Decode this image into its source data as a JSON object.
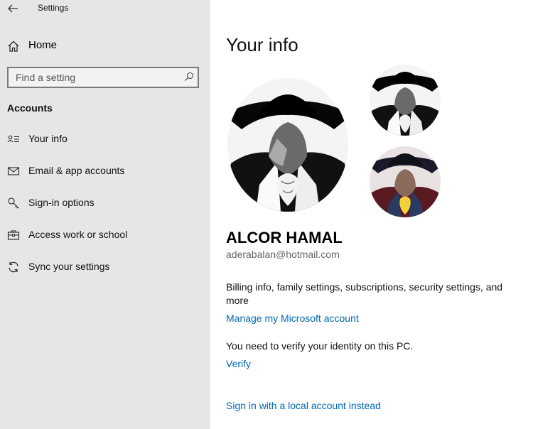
{
  "app": {
    "title": "Settings"
  },
  "sidebar": {
    "home_label": "Home",
    "search_placeholder": "Find a setting",
    "section_title": "Accounts",
    "items": [
      {
        "label": "Your info",
        "icon": "person-card-icon"
      },
      {
        "label": "Email & app accounts",
        "icon": "mail-icon"
      },
      {
        "label": "Sign-in options",
        "icon": "key-icon"
      },
      {
        "label": "Access work or school",
        "icon": "briefcase-icon"
      },
      {
        "label": "Sync your settings",
        "icon": "sync-icon"
      }
    ]
  },
  "main": {
    "title": "Your info",
    "user_name": "ALCOR HAMAL",
    "user_email": "aderabalan@hotmail.com",
    "billing_text": "Billing info, family settings, subscriptions, security settings, and more",
    "manage_link": "Manage my Microsoft account",
    "verify_text": "You need to verify your identity on this PC.",
    "verify_link": "Verify",
    "local_account_link": "Sign in with a local account instead"
  }
}
